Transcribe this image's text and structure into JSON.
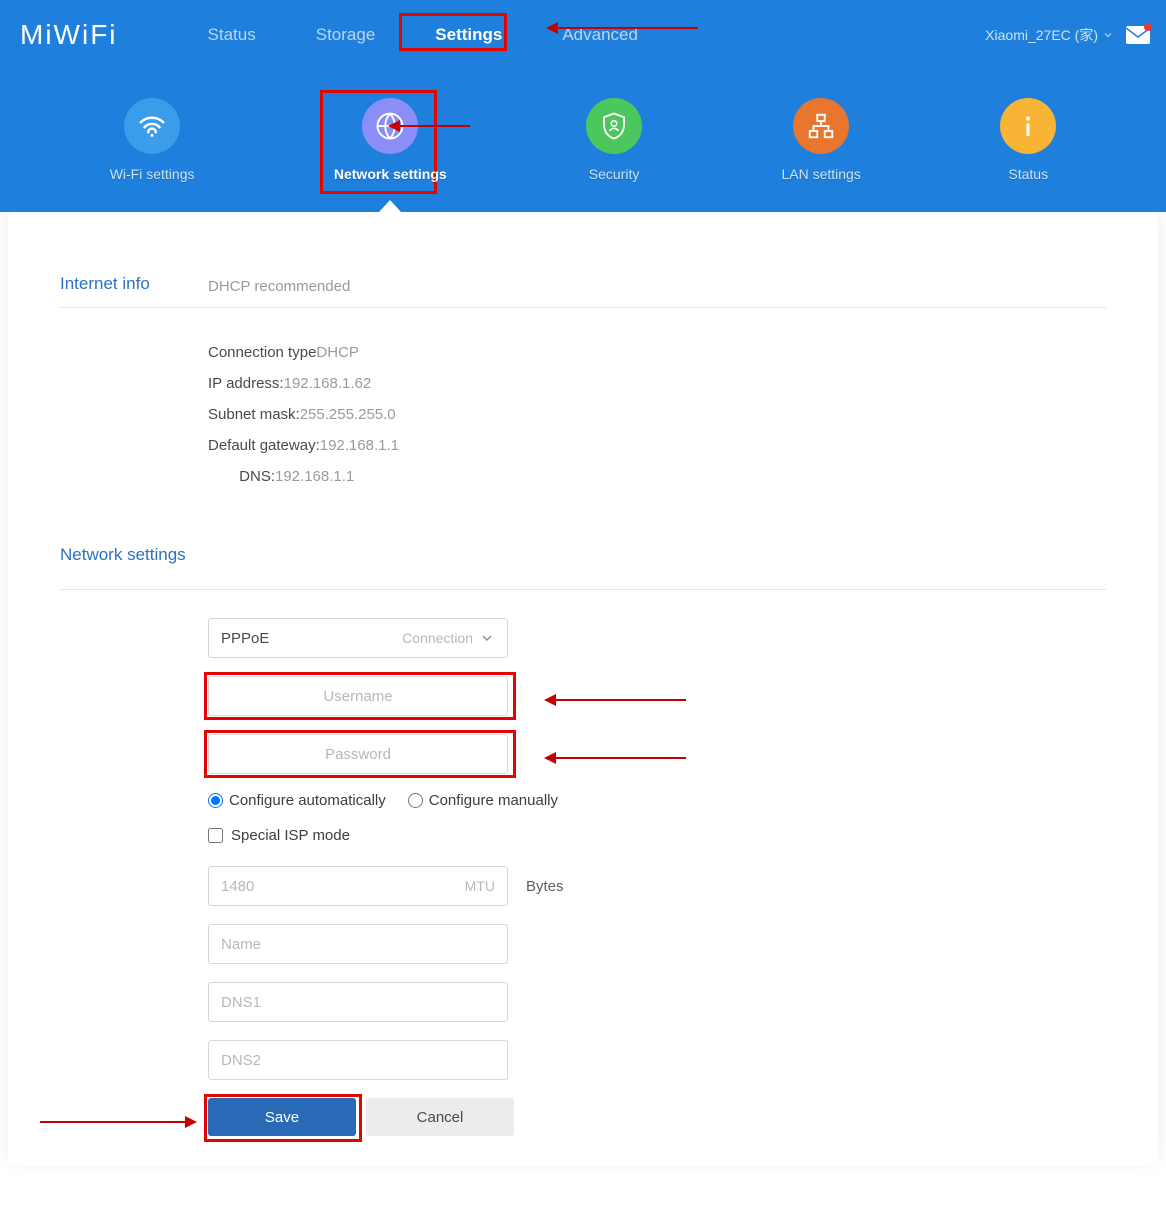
{
  "logo": "MiWiFi",
  "topnav": {
    "items": [
      "Status",
      "Storage",
      "Settings",
      "Advanced"
    ],
    "activeIndex": 2
  },
  "deviceName": "Xiaomi_27EC (家)",
  "subnav": {
    "items": [
      {
        "label": "Wi-Fi settings",
        "icon": "wifi",
        "color": "blue"
      },
      {
        "label": "Network settings",
        "icon": "globe",
        "color": "purple"
      },
      {
        "label": "Security",
        "icon": "shield",
        "color": "green"
      },
      {
        "label": "LAN settings",
        "icon": "lan",
        "color": "orange"
      },
      {
        "label": "Status",
        "icon": "info",
        "color": "amber"
      }
    ],
    "activeIndex": 1
  },
  "internetInfo": {
    "title": "Internet info",
    "subtitle": "DHCP recommended",
    "rows": {
      "connType": {
        "label": "Connection type",
        "value": "DHCP"
      },
      "ip": {
        "label": "IP address:",
        "value": "192.168.1.62"
      },
      "subnet": {
        "label": "Subnet mask:",
        "value": "255.255.255.0"
      },
      "gateway": {
        "label": "Default gateway:",
        "value": "192.168.1.1"
      },
      "dns": {
        "label": "DNS:",
        "value": "192.168.1.1"
      }
    }
  },
  "networkSettings": {
    "title": "Network settings",
    "connectionSelect": {
      "value": "PPPoE",
      "suffix": "Connection"
    },
    "username": {
      "placeholder": "Username",
      "value": ""
    },
    "password": {
      "placeholder": "Password",
      "value": ""
    },
    "config": {
      "auto": "Configure automatically",
      "manual": "Configure manually",
      "selected": "auto"
    },
    "specialISP": {
      "label": "Special ISP mode",
      "checked": false
    },
    "mtu": {
      "value": "1480",
      "suffix": "MTU",
      "unit": "Bytes"
    },
    "name": {
      "placeholder": "Name",
      "value": ""
    },
    "dns1": {
      "placeholder": "DNS1",
      "value": ""
    },
    "dns2": {
      "placeholder": "DNS2",
      "value": ""
    },
    "save": "Save",
    "cancel": "Cancel"
  }
}
